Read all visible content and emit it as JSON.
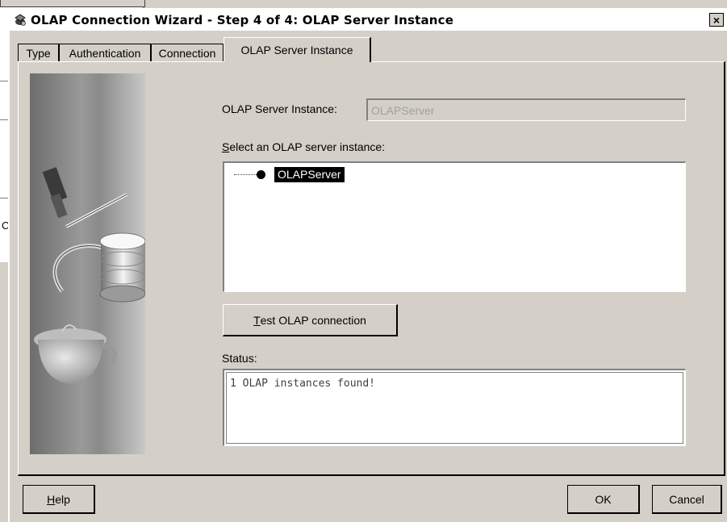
{
  "dialog": {
    "title": "OLAP Connection Wizard - Step 4 of 4: OLAP Server Instance",
    "close_label": "×"
  },
  "background": {
    "partial_letter": "C"
  },
  "tabs": [
    {
      "label": "Type",
      "active": false
    },
    {
      "label": "Authentication",
      "active": false
    },
    {
      "label": "Connection",
      "active": false
    },
    {
      "label": "OLAP Server Instance",
      "active": true
    }
  ],
  "form": {
    "instance_label": "OLAP Server Instance:",
    "instance_value": "OLAPServer",
    "select_label_prefix": "S",
    "select_label_rest": "elect an OLAP server instance:",
    "tree": {
      "items": [
        {
          "label": "OLAPServer",
          "selected": true
        }
      ]
    },
    "test_button_prefix": "T",
    "test_button_rest": "est OLAP connection",
    "status_label": "Status:",
    "status_text": "1 OLAP instances found!"
  },
  "footer": {
    "help_prefix": "H",
    "help_rest": "elp",
    "ok_label": "OK",
    "cancel_label": "Cancel"
  },
  "colors": {
    "dialog_bg": "#d4d0c8",
    "selection_bg": "#000000",
    "disabled_text": "#a0a0a0"
  },
  "icons": [
    "wizard-app-icon",
    "close-icon",
    "tree-node-icon",
    "database-illustration"
  ]
}
